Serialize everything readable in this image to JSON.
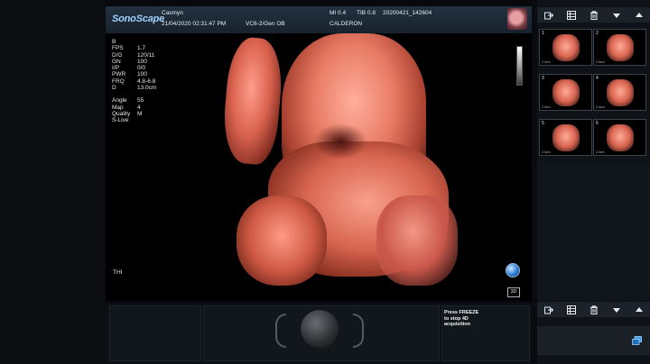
{
  "header": {
    "brand": "SonoScape",
    "patient_name": "Casmyn",
    "datetime": "21/04/2020 02:31:47 PM",
    "probe_preset": "VC6-2/Gen OB",
    "mi": "MI 0.4",
    "tib": "TIB 0.8",
    "exam_id": "20200421_142604",
    "hospital": "CALDERON"
  },
  "params": {
    "mode": "B",
    "rows": [
      {
        "k": "FPS",
        "v": "1.7"
      },
      {
        "k": "D/G",
        "v": "120/11"
      },
      {
        "k": "GN",
        "v": "100"
      },
      {
        "k": "I/P",
        "v": "0/0"
      },
      {
        "k": "PWR",
        "v": "100"
      },
      {
        "k": "FRQ",
        "v": "4.8-6.8"
      },
      {
        "k": "D",
        "v": "13.0cm"
      }
    ],
    "rows2": [
      {
        "k": "Angle",
        "v": "55"
      },
      {
        "k": "Map",
        "v": "4"
      },
      {
        "k": "Quality",
        "v": "M"
      }
    ],
    "live_label": "S-Live",
    "thi_label": "THI",
    "mode_3d": "3D"
  },
  "freeze_message": [
    "Press FREEZE",
    "to stop 4D",
    "acquisition"
  ],
  "thumbnails": [
    {
      "num": "1",
      "foot": "2.0cm"
    },
    {
      "num": "2",
      "foot": "2.0cm"
    },
    {
      "num": "3",
      "foot": "2.0cm"
    },
    {
      "num": "4",
      "foot": "2.0cm"
    },
    {
      "num": "5",
      "foot": "2.0cm"
    },
    {
      "num": "6",
      "foot": "2.0cm"
    }
  ],
  "icons": [
    "export-icon",
    "grid-view-icon",
    "delete-icon",
    "arrow-down-icon",
    "arrow-up-icon",
    "expand-icon",
    "globe-icon"
  ]
}
